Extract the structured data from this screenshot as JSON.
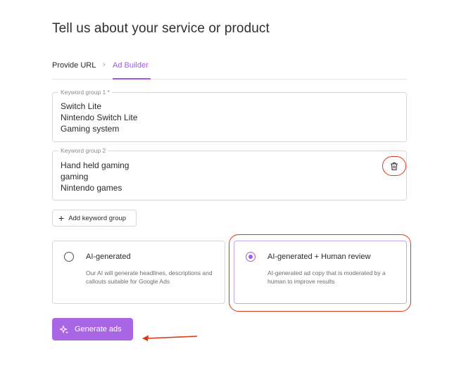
{
  "page": {
    "title": "Tell us about your service or product"
  },
  "tabs": [
    {
      "label": "Provide URL",
      "active": false
    },
    {
      "label": "Ad Builder",
      "active": true
    }
  ],
  "breadcrumb_separator": "›",
  "keyword_groups": [
    {
      "label": "Keyword group 1 *",
      "lines": [
        "Switch Lite",
        "Nintendo Switch Lite",
        "Gaming system"
      ]
    },
    {
      "label": "Keyword group 2",
      "lines": [
        "Hand held gaming",
        "gaming",
        "Nintendo games"
      ],
      "delete_icon": "trash-icon"
    }
  ],
  "add_keyword_group": {
    "label": "Add keyword group",
    "icon": "plus-icon"
  },
  "options": [
    {
      "title": "AI-generated",
      "description": "Our AI will generate headlines, descriptions and callouts suitable for Google Ads",
      "selected": false
    },
    {
      "title": "AI-generated + Human review",
      "description": "AI-generated ad copy that is moderated by a human to improve results",
      "selected": true
    }
  ],
  "generate_button": {
    "label": "Generate ads",
    "icon": "sparkle-icon"
  },
  "colors": {
    "accent": "#a25ae0",
    "button": "#a866e4",
    "annotation": "#d9391b"
  }
}
